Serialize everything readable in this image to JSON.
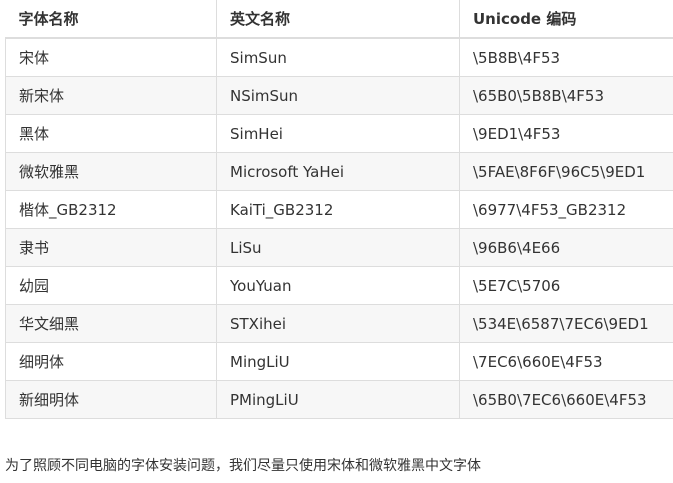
{
  "table": {
    "headers": [
      "字体名称",
      "英文名称",
      "Unicode 编码"
    ],
    "rows": [
      [
        "宋体",
        "SimSun",
        "\\5B8B\\4F53"
      ],
      [
        "新宋体",
        "NSimSun",
        "\\65B0\\5B8B\\4F53"
      ],
      [
        "黑体",
        "SimHei",
        "\\9ED1\\4F53"
      ],
      [
        "微软雅黑",
        "Microsoft YaHei",
        "\\5FAE\\8F6F\\96C5\\9ED1"
      ],
      [
        "楷体_GB2312",
        "KaiTi_GB2312",
        "\\6977\\4F53_GB2312"
      ],
      [
        "隶书",
        "LiSu",
        "\\96B6\\4E66"
      ],
      [
        "幼园",
        "YouYuan",
        "\\5E7C\\5706"
      ],
      [
        "华文细黑",
        "STXihei",
        "\\534E\\6587\\7EC6\\9ED1"
      ],
      [
        "细明体",
        "MingLiU",
        "\\7EC6\\660E\\4F53"
      ],
      [
        "新细明体",
        "PMingLiU",
        "\\65B0\\7EC6\\660E\\4F53"
      ]
    ]
  },
  "note": "为了照顾不同电脑的字体安装问题，我们尽量只使用宋体和微软雅黑中文字体"
}
